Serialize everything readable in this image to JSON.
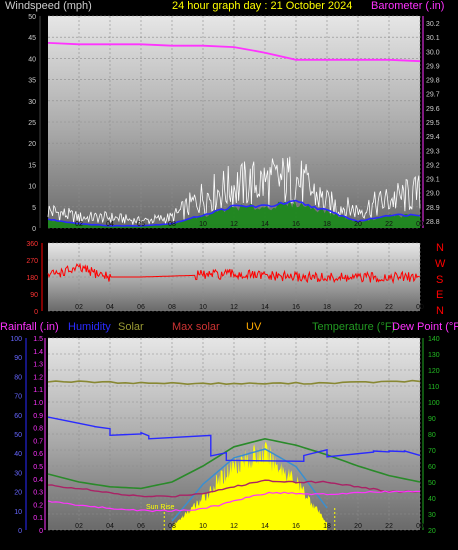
{
  "header": {
    "wind_label": "Windspeed (mph)",
    "title": "24 hour graph day : 21 October 2024",
    "baro_label": "Barometer (.in)"
  },
  "direction_letters": [
    "N",
    "W",
    "S",
    "E",
    "N"
  ],
  "bottom_legend": {
    "rain": "Rainfall (.in)",
    "humidity": "Humidity",
    "solar": "Solar",
    "max_solar": "Max solar",
    "uv": "UV",
    "temperature": "Temperature (°F)",
    "dew": "Dew Point (°F)"
  },
  "sunrise_label": "Sun Rise",
  "colors": {
    "wind_avg": "#2a2aff",
    "gust": "#ffffff",
    "wind_fill": "#1a8a1a",
    "barometer": "#ff33ff",
    "direction": "#ff0000",
    "humidity": "#2a2aff",
    "solar": "#ffff00",
    "max_solar": "#3a8fd0",
    "temperature": "#2a8a2a",
    "dew": "#aa2266",
    "uv": "#ffff00",
    "olive": "#888833",
    "rain": "#ff33ff"
  },
  "x_ticks": [
    "02",
    "04",
    "06",
    "08",
    "10",
    "12",
    "14",
    "16",
    "18",
    "20",
    "22",
    "00"
  ],
  "chart_data": [
    {
      "type": "line",
      "title": "24 hour graph day : 21 October 2024",
      "x": [
        0,
        2,
        4,
        6,
        8,
        10,
        12,
        14,
        16,
        18,
        20,
        22,
        24
      ],
      "y_left_label": "Windspeed (mph)",
      "y_left_ticks": [
        0,
        5,
        10,
        15,
        20,
        25,
        30,
        35,
        40,
        45,
        50
      ],
      "ylim_left": [
        0,
        50
      ],
      "y_right_label": "Barometer (.in)",
      "y_right_ticks": [
        28.8,
        28.9,
        29.0,
        29.1,
        29.2,
        29.3,
        29.4,
        29.5,
        29.6,
        29.7,
        29.8,
        29.9,
        30.0,
        30.1,
        30.2
      ],
      "ylim_right": [
        28.75,
        30.25
      ],
      "series": [
        {
          "name": "Barometer (.in)",
          "axis": "right",
          "values": [
            30.06,
            30.05,
            30.05,
            30.05,
            30.04,
            30.04,
            30.03,
            29.99,
            29.94,
            29.94,
            29.94,
            29.94,
            29.93
          ]
        },
        {
          "name": "wind_avg",
          "axis": "left",
          "values": [
            2,
            1,
            0.5,
            0.5,
            1,
            3,
            5,
            5,
            6,
            4,
            1.5,
            3,
            3
          ]
        },
        {
          "name": "gust",
          "axis": "left",
          "values": [
            5,
            3,
            3,
            2,
            3,
            9,
            12,
            13,
            14,
            7,
            5,
            8,
            10
          ]
        }
      ]
    },
    {
      "type": "scatter",
      "y_ticks": [
        0,
        90,
        180,
        270,
        360
      ],
      "ylim": [
        0,
        360
      ],
      "series": [
        {
          "name": "direction",
          "values": [
            190,
            225,
            180,
            180,
            185,
            190,
            195,
            185,
            180,
            175,
            175,
            180,
            180
          ]
        }
      ]
    },
    {
      "type": "line",
      "y_rain_ticks": [
        0,
        0.1,
        0.2,
        0.3,
        0.4,
        0.5,
        0.6,
        0.7,
        0.8,
        0.9,
        1.0,
        1.1,
        1.2,
        1.3,
        1.4,
        1.5
      ],
      "ylim_rain": [
        0,
        1.5
      ],
      "y_humidity_ticks": [
        0,
        10,
        20,
        30,
        40,
        50,
        60,
        70,
        80,
        90,
        100
      ],
      "ylim_humidity": [
        0,
        100
      ],
      "y_temp_ticks": [
        20,
        30,
        40,
        50,
        60,
        70,
        80,
        90,
        100,
        110,
        120,
        130,
        140
      ],
      "ylim_temp": [
        20,
        140
      ],
      "series": [
        {
          "name": "Humidity",
          "axis": "humidity",
          "values": [
            58,
            55,
            50,
            50,
            45,
            40,
            37,
            37,
            40,
            40,
            40,
            40,
            40
          ]
        },
        {
          "name": "Temperature (°F)",
          "axis": "temp",
          "values": [
            55,
            50,
            47,
            46,
            50,
            60,
            72,
            77,
            73,
            67,
            60,
            54,
            50
          ]
        },
        {
          "name": "Dew Point (°F)",
          "axis": "temp",
          "values": [
            48,
            46,
            43,
            41,
            41,
            43,
            47,
            51,
            50,
            50,
            47,
            44,
            44
          ]
        },
        {
          "name": "Solar",
          "axis": "temp",
          "values": [
            0,
            0,
            0,
            0,
            5,
            45,
            95,
            110,
            70,
            10,
            0,
            0,
            0
          ]
        },
        {
          "name": "Max solar",
          "axis": "temp",
          "values": [
            0,
            0,
            0,
            0,
            10,
            52,
            82,
            92,
            72,
            25,
            0,
            0,
            0
          ]
        },
        {
          "name": "Rainfall (.in)",
          "axis": "rain",
          "values": [
            0,
            0,
            0,
            0,
            0,
            0,
            0,
            0,
            0,
            0,
            0,
            0,
            0
          ]
        }
      ]
    }
  ]
}
